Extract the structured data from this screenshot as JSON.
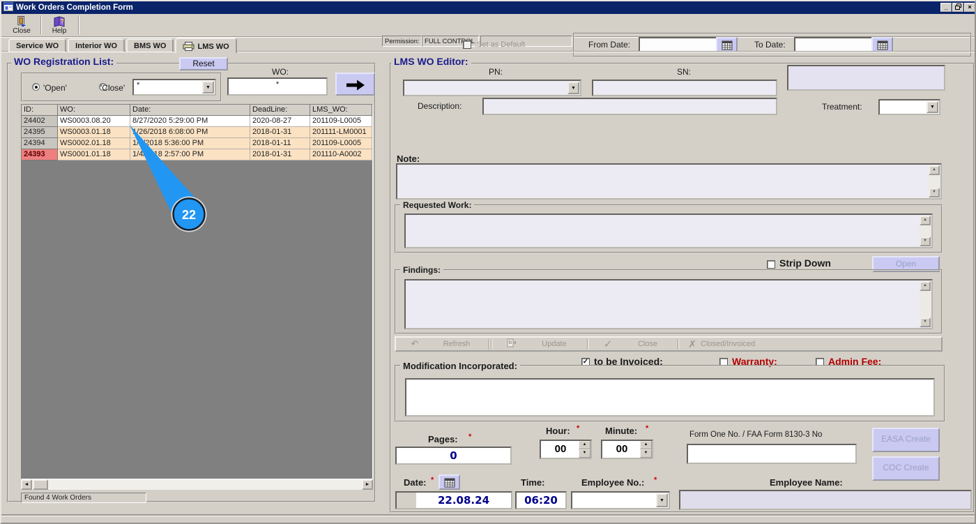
{
  "window": {
    "title": "Work Orders Completion Form"
  },
  "icons": {
    "minimize": "_",
    "close_x": "×",
    "dropdown": "▼",
    "spin_up": "▲",
    "spin_down": "▼",
    "scroll_up": "▲",
    "scroll_down": "▼",
    "scroll_left": "◄",
    "scroll_right": "►",
    "check": "✓",
    "x_mark": "✗",
    "undo": "↶"
  },
  "toolbar": {
    "close_label": "Close",
    "help_label": "Help",
    "permission_label": "Permission:",
    "permission_value": "FULL CONTROL"
  },
  "tabs": [
    {
      "label": "Service WO",
      "active": false
    },
    {
      "label": "Interior WO",
      "active": false
    },
    {
      "label": "BMS WO",
      "active": false
    },
    {
      "label": "LMS WO",
      "active": true
    }
  ],
  "filters": {
    "set_as_default_label": ":Set as Default",
    "from_date_label": "From Date:",
    "from_date_value": "",
    "to_date_label": "To Date:",
    "to_date_value": ""
  },
  "registration_list": {
    "title": "WO Registration List:",
    "reset_label": "Reset",
    "radio_open_label": "'Open'",
    "radio_close_label": "'Close'",
    "radio_selected": "open",
    "filter_dropdown_value": "*",
    "wo_label": "WO:",
    "wo_value": "*",
    "table": {
      "columns": [
        "ID:",
        "WO:",
        "Date:",
        "DeadLine:",
        "LMS_WO:"
      ],
      "rows": [
        {
          "id": "24402",
          "wo": "WS0003.08.20",
          "date": "8/27/2020 5:29:00 PM",
          "deadline": "2020-08-27",
          "lms_wo": "201109-L0005",
          "highlight": "white",
          "id_alert": false
        },
        {
          "id": "24395",
          "wo": "WS0003.01.18",
          "date": "1/26/2018 6:08:00 PM",
          "deadline": "2018-01-31",
          "lms_wo": "201111-LM0001",
          "highlight": "peach",
          "id_alert": false
        },
        {
          "id": "24394",
          "wo": "WS0002.01.18",
          "date": "1/4/2018 5:36:00 PM",
          "deadline": "2018-01-11",
          "lms_wo": "201109-L0005",
          "highlight": "peach",
          "id_alert": false
        },
        {
          "id": "24393",
          "wo": "WS0001.01.18",
          "date": "1/4/2018 2:57:00 PM",
          "deadline": "2018-01-31",
          "lms_wo": "201110-A0002",
          "highlight": "peach",
          "id_alert": true
        }
      ]
    },
    "status_text": "Found 4 Work Orders"
  },
  "editor": {
    "title": "LMS WO Editor:",
    "pn_label": "PN:",
    "pn_value": "",
    "sn_label": "SN:",
    "sn_value": "",
    "description_label": "Description:",
    "description_value": "",
    "treatment_label": "Treatment:",
    "treatment_value": "",
    "note_label": "Note:",
    "note_value": "",
    "requested_work_label": "Requested Work:",
    "requested_work_value": "",
    "strip_down_label": "Strip Down",
    "strip_down_checked": false,
    "open_button_label": "Open",
    "findings_label": "Findings:",
    "findings_value": "",
    "actions": [
      {
        "label": "Refresh"
      },
      {
        "label": "Update"
      },
      {
        "label": "Close"
      },
      {
        "label": "Closed/Invoiced"
      }
    ],
    "to_be_invoiced_label": "to be Invoiced:",
    "to_be_invoiced_checked": true,
    "warranty_label": "Warranty:",
    "warranty_checked": false,
    "admin_fee_label": "Admin Fee:",
    "admin_fee_checked": false,
    "modification_label": "Modification Incorporated:",
    "modification_value": "",
    "pages_label": "Pages:",
    "pages_value": "0",
    "hour_label": "Hour:",
    "hour_value": "00",
    "minute_label": "Minute:",
    "minute_value": "00",
    "form_one_label": "Form One No. / FAA Form 8130-3 No",
    "form_one_value": "",
    "easa_create_label": "EASA Create",
    "coc_create_label": "COC Create",
    "date_label": "Date:",
    "date_value": "22.08.24",
    "time_label": "Time:",
    "time_value": "06:20",
    "employee_no_label": "Employee No.:",
    "employee_no_value": "",
    "employee_name_label": "Employee Name:",
    "employee_name_value": "",
    "required_marker": "*"
  },
  "annotation": {
    "label": "22",
    "color": "#2196f3"
  },
  "colors": {
    "titlebar": "#0a246a",
    "accent_button": "#c9c9f2",
    "row_highlight": "#fbe2c3",
    "row_alert": "#ef7f7f",
    "annotation": "#2196f3",
    "value_text": "#00008b",
    "required_marker": "#cc0000",
    "warning_label": "#b40000",
    "group_title": "#1a1a8c"
  }
}
